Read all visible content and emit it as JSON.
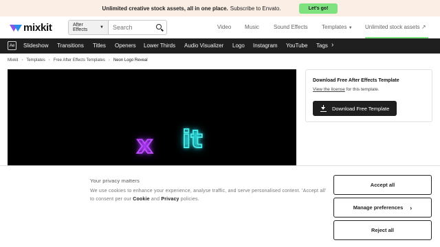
{
  "promo": {
    "lead": "Unlimited creative stock assets, all in one place.",
    "text": "Subscribe to Envato.",
    "cta": "Let's go!",
    "cta_color": "#7ee37e",
    "bg_color": "#fbeee4"
  },
  "header": {
    "logo_text": "mixkit",
    "search": {
      "category": "After Effects",
      "placeholder": "Search"
    },
    "nav": [
      "Video",
      "Music",
      "Sound Effects",
      "Templates",
      "Unlimited stock assets"
    ]
  },
  "categories": {
    "ae_badge": "Ae",
    "items": [
      "Slideshow",
      "Transitions",
      "Titles",
      "Openers",
      "Lower Thirds",
      "Audio Visualizer",
      "Logo",
      "Instagram",
      "YouTube",
      "Tags"
    ]
  },
  "breadcrumb": [
    "Mixkit",
    "Templates",
    "Free After Effects Templates",
    "Neon Logo Reveal"
  ],
  "preview": {
    "neon_colors": [
      "#c04bff",
      "#44e6e6"
    ]
  },
  "download": {
    "title": "Download Free After Effects Template",
    "license_link": "View the license",
    "license_suffix": "for this template.",
    "button": "Download Free Template"
  },
  "consent": {
    "title": "Your privacy matters",
    "text_1": "We use cookies to enhance your experience, analyse traffic, and serve personalised content. 'Accept all' to consent per our",
    "cookie": "Cookie",
    "and": "and",
    "privacy": "Privacy",
    "policies": "policies.",
    "accept": "Accept all",
    "manage": "Manage preferences",
    "reject": "Reject all"
  }
}
